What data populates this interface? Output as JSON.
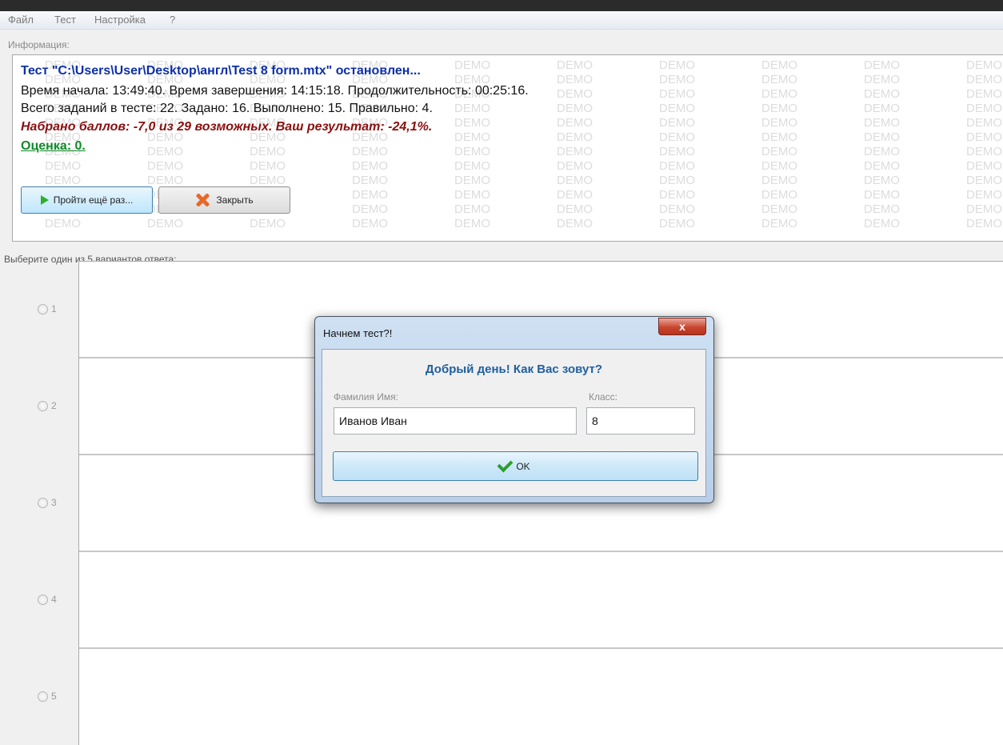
{
  "menu": [
    "Файл",
    "Тест",
    "Настройка",
    "?"
  ],
  "info": {
    "label": "Информация:",
    "title": "Тест \"C:\\Users\\User\\Desktop\\англ\\Test 8 form.mtx\" остановлен...",
    "times": "Время начала: 13:49:40. Время завершения: 14:15:18. Продолжительность: 00:25:16.",
    "tasks": "Всего заданий в тесте: 22. Задано: 16. Выполнено: 15. Правильно: 4.",
    "score": "Набрано баллов: -7,0 из 29 возможных. Ваш результат: -24,1%.",
    "grade": "Оценка: 0.",
    "watermark": "DEMO",
    "retry_label": "Пройти ещё раз...",
    "close_label": "Закрыть"
  },
  "question": {
    "prompt": "Выберите один из 5 вариантов ответа:",
    "options": [
      "1",
      "2",
      "3",
      "4",
      "5"
    ]
  },
  "dialog": {
    "title": "Начнем тест?!",
    "close_glyph": "x",
    "greeting": "Добрый день! Как Вас зовут?",
    "name_label": "Фамилия Имя:",
    "name_value": "Иванов Иван",
    "class_label": "Класс:",
    "class_value": "8",
    "ok_label": "OK"
  },
  "colors": {
    "title_blue": "#0d2fa8",
    "score_red": "#8a1010",
    "grade_green": "#108a2a",
    "greeting_blue": "#1f5f9f"
  }
}
